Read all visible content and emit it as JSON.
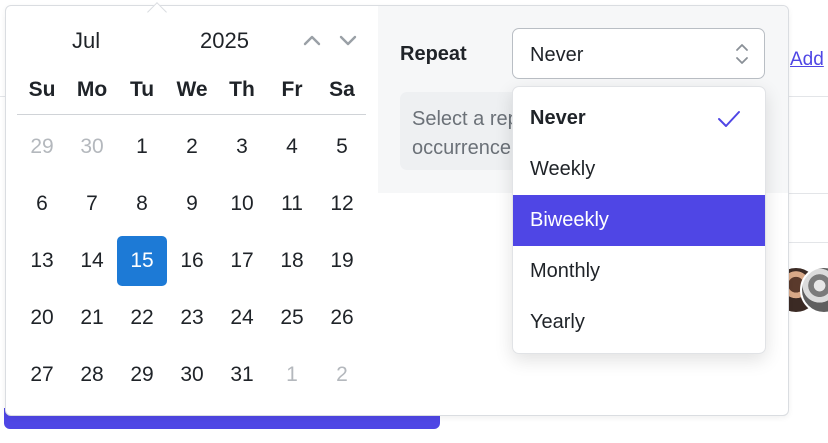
{
  "background": {
    "add_link": "Add"
  },
  "calendar": {
    "month": "Jul",
    "year": "2025",
    "weekdays": [
      "Su",
      "Mo",
      "Tu",
      "We",
      "Th",
      "Fr",
      "Sa"
    ],
    "weeks": [
      [
        {
          "d": "29",
          "muted": true
        },
        {
          "d": "30",
          "muted": true
        },
        {
          "d": "1"
        },
        {
          "d": "2"
        },
        {
          "d": "3"
        },
        {
          "d": "4"
        },
        {
          "d": "5"
        }
      ],
      [
        {
          "d": "6"
        },
        {
          "d": "7"
        },
        {
          "d": "8"
        },
        {
          "d": "9"
        },
        {
          "d": "10"
        },
        {
          "d": "11"
        },
        {
          "d": "12"
        }
      ],
      [
        {
          "d": "13"
        },
        {
          "d": "14"
        },
        {
          "d": "15",
          "selected": true
        },
        {
          "d": "16"
        },
        {
          "d": "17"
        },
        {
          "d": "18"
        },
        {
          "d": "19"
        }
      ],
      [
        {
          "d": "20"
        },
        {
          "d": "21"
        },
        {
          "d": "22"
        },
        {
          "d": "23"
        },
        {
          "d": "24"
        },
        {
          "d": "25"
        },
        {
          "d": "26"
        }
      ],
      [
        {
          "d": "27"
        },
        {
          "d": "28"
        },
        {
          "d": "29"
        },
        {
          "d": "30"
        },
        {
          "d": "31"
        },
        {
          "d": "1",
          "muted": true
        },
        {
          "d": "2",
          "muted": true
        }
      ]
    ],
    "selected_color": "#1d7ad6"
  },
  "repeat": {
    "label": "Repeat",
    "value": "Never",
    "hint_line1": "Select a repeat pattern",
    "hint_line2": "occurrence"
  },
  "menu": {
    "options": [
      {
        "label": "Never",
        "checked": true,
        "bold": true
      },
      {
        "label": "Weekly"
      },
      {
        "label": "Biweekly",
        "highlighted": true
      },
      {
        "label": "Monthly"
      },
      {
        "label": "Yearly"
      }
    ],
    "highlight_color": "#4f46e5"
  }
}
